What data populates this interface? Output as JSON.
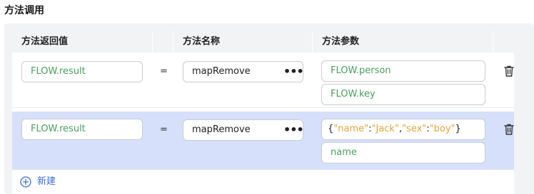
{
  "section": {
    "title": "方法调用"
  },
  "table": {
    "headers": [
      "方法返回值",
      "方法名称",
      "方法参数"
    ]
  },
  "rows": [
    {
      "return_value": "FLOW.result",
      "equals": "=",
      "method": "mapRemove",
      "more": "•••",
      "params": [
        "FLOW.person",
        "FLOW.key"
      ]
    },
    {
      "return_value": "FLOW.result",
      "equals": "=",
      "method": "mapRemove",
      "more": "•••",
      "params_json": {
        "brace_open": "{",
        "k1": "\"name\"",
        "colon1": ":",
        "v1": "\"Jack\"",
        "comma": ",",
        "k2": "\"sex\"",
        "colon2": ":",
        "v2": "\"boy\"",
        "brace_close": "}"
      },
      "params_second": "name"
    }
  ],
  "add": {
    "label": "新建"
  },
  "colors": {
    "accent": "#3b6fd8",
    "value_green": "#49a05c",
    "json_orange": "#e8a23a",
    "selected_row": "#d6e0fb"
  },
  "icons": {
    "delete": "trash-icon",
    "add": "plus-circle-icon",
    "more": "more-horizontal-icon"
  }
}
